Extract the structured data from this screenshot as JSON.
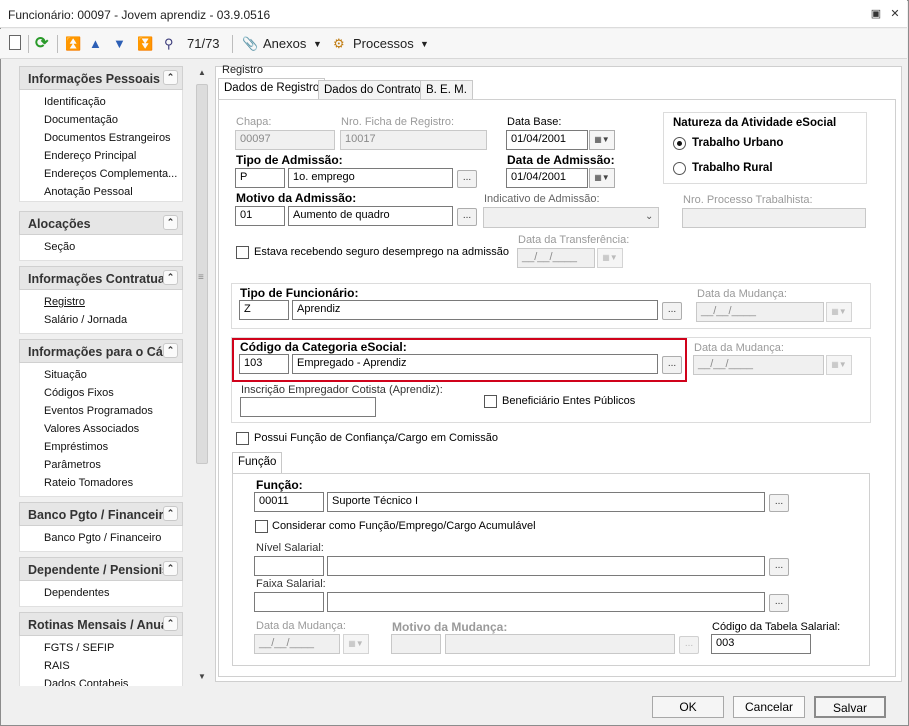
{
  "window": {
    "title": "Funcionário: 00097 - Jovem aprendiz - 03.9.0516"
  },
  "toolbar": {
    "record_counter": "71/73",
    "anexos": "Anexos",
    "processos": "Processos"
  },
  "sidebar": {
    "sections": [
      {
        "title": "Informações Pessoais",
        "items": [
          "Identificação",
          "Documentação",
          "Documentos Estrangeiros",
          "Endereço Principal",
          "Endereços Complementa...",
          "Anotação Pessoal"
        ]
      },
      {
        "title": "Alocações",
        "items": [
          "Seção"
        ]
      },
      {
        "title": "Informações Contratua",
        "items": [
          "Registro",
          "Salário / Jornada"
        ]
      },
      {
        "title": "Informações para o Cál",
        "items": [
          "Situação",
          "Códigos Fixos",
          "Eventos Programados",
          "Valores Associados",
          "Empréstimos",
          "Parâmetros",
          "Rateio Tomadores"
        ]
      },
      {
        "title": "Banco Pgto / Financeiro",
        "items": [
          "Banco Pgto / Financeiro"
        ]
      },
      {
        "title": "Dependente / Pensionis",
        "items": [
          "Dependentes"
        ]
      },
      {
        "title": "Rotinas Mensais / Anua",
        "items": [
          "FGTS / SEFIP",
          "RAIS",
          "Dados Contabeis"
        ]
      }
    ]
  },
  "content": {
    "group_title": "Registro",
    "tabs": [
      "Dados de Registro",
      "Dados do Contrato",
      "B. E. M."
    ],
    "chapa": {
      "label": "Chapa:",
      "value": "00097"
    },
    "ficha": {
      "label": "Nro. Ficha de Registro:",
      "value": "10017"
    },
    "data_base": {
      "label": "Data Base:",
      "value": "01/04/2001"
    },
    "tipo_admissao": {
      "label": "Tipo de Admissão:",
      "code": "P",
      "desc": "1o. emprego"
    },
    "data_admissao": {
      "label": "Data de Admissão:",
      "value": "01/04/2001"
    },
    "motivo_admissao": {
      "label": "Motivo da Admissão:",
      "code": "01",
      "desc": "Aumento de quadro"
    },
    "indicativo": {
      "label": "Indicativo de Admissão:",
      "value": ""
    },
    "processo": {
      "label": "Nro. Processo Trabalhista:",
      "value": ""
    },
    "natureza": {
      "title": "Natureza da Atividade eSocial",
      "opt1": "Trabalho Urbano",
      "opt2": "Trabalho Rural"
    },
    "seguro": {
      "label": "Estava recebendo seguro desemprego na admissão"
    },
    "transferencia": {
      "label": "Data da Transferência:",
      "value": "__/__/____"
    },
    "tipo_func": {
      "label": "Tipo de Funcionário:",
      "code": "Z",
      "desc": "Aprendiz"
    },
    "mudanca1": {
      "label": "Data da Mudança:",
      "value": "__/__/____"
    },
    "categoria": {
      "label": "Código da Categoria eSocial:",
      "code": "103",
      "desc": "Empregado - Aprendiz"
    },
    "mudanca2": {
      "label": "Data da Mudança:",
      "value": "__/__/____"
    },
    "cotista": {
      "label": "Inscrição Empregador Cotista (Aprendiz):",
      "value": ""
    },
    "beneficiario": {
      "label": "Beneficiário Entes Públicos"
    },
    "confianca": {
      "label": "Possui Função de Confiança/Cargo em Comissão"
    },
    "funcao_tab": "Função",
    "funcao": {
      "label": "Função:",
      "code": "00011",
      "desc": "Suporte Técnico I"
    },
    "acumulavel": {
      "label": "Considerar como Função/Emprego/Cargo Acumulável"
    },
    "nivel": {
      "label": "Nível Salarial:"
    },
    "faixa": {
      "label": "Faixa Salarial:"
    },
    "mudanca3": {
      "label": "Data da Mudança:",
      "value": "__/__/____"
    },
    "motivo_mud": {
      "label": "Motivo da Mudança:"
    },
    "tabela_sal": {
      "label": "Código da Tabela Salarial:",
      "value": "003"
    }
  },
  "footer": {
    "ok": "OK",
    "cancel": "Cancelar",
    "save": "Salvar"
  },
  "colors": {
    "highlight": "#d0021b"
  }
}
